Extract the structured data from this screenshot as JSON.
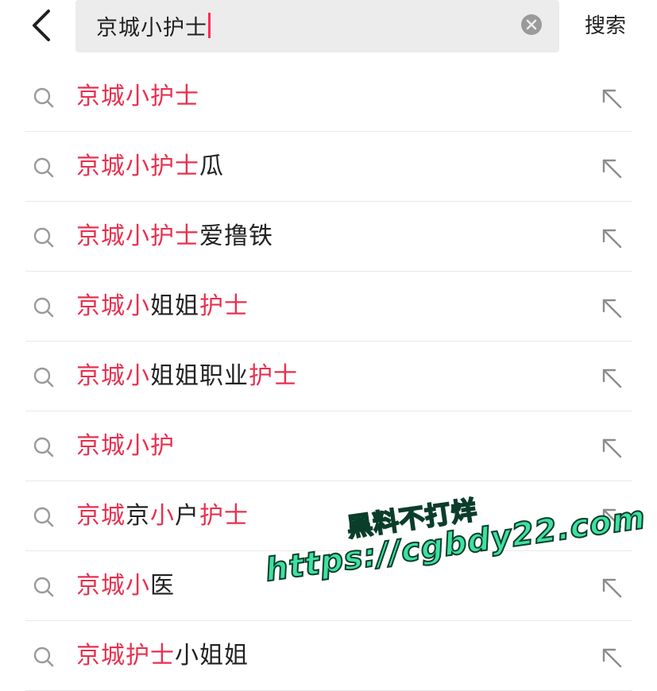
{
  "header": {
    "back_icon": "chevron-left-icon",
    "query": "京城小护士",
    "clear_icon": "clear-circle-icon",
    "search_label": "搜索"
  },
  "suggestions": [
    {
      "segments": [
        {
          "text": "京城小护士",
          "hl": true
        }
      ]
    },
    {
      "segments": [
        {
          "text": "京城小护士",
          "hl": true
        },
        {
          "text": "瓜",
          "hl": false
        }
      ]
    },
    {
      "segments": [
        {
          "text": "京城小护士",
          "hl": true
        },
        {
          "text": "爱撸铁",
          "hl": false
        }
      ]
    },
    {
      "segments": [
        {
          "text": "京城小",
          "hl": true
        },
        {
          "text": "姐姐",
          "hl": false
        },
        {
          "text": "护士",
          "hl": true
        }
      ]
    },
    {
      "segments": [
        {
          "text": "京城小",
          "hl": true
        },
        {
          "text": "姐姐职业",
          "hl": false
        },
        {
          "text": "护士",
          "hl": true
        }
      ]
    },
    {
      "segments": [
        {
          "text": "京城小护",
          "hl": true
        }
      ]
    },
    {
      "segments": [
        {
          "text": "京城",
          "hl": true
        },
        {
          "text": "京",
          "hl": false
        },
        {
          "text": "小",
          "hl": true
        },
        {
          "text": "户",
          "hl": false
        },
        {
          "text": "护士",
          "hl": true
        }
      ]
    },
    {
      "segments": [
        {
          "text": "京城小",
          "hl": true
        },
        {
          "text": "医",
          "hl": false
        }
      ]
    },
    {
      "segments": [
        {
          "text": "京城护士",
          "hl": true
        },
        {
          "text": "小姐姐",
          "hl": false
        }
      ]
    }
  ],
  "watermark": {
    "line1": "黑料不打烊",
    "line2": "https://cgbdy22.com"
  },
  "colors": {
    "highlight": "#e8304f",
    "caret": "#fe2c55",
    "text": "#222222",
    "search_bg": "#ececec",
    "watermark": "#3fe0a0"
  }
}
